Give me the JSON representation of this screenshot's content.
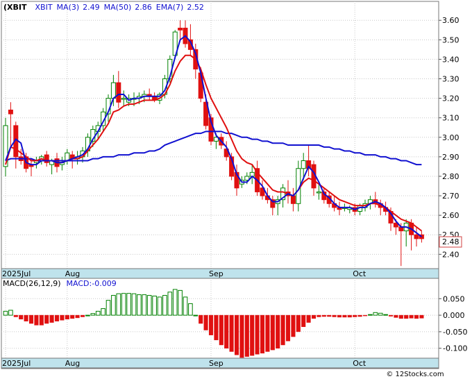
{
  "colors": {
    "ma_short": "#1010d0",
    "ma_long": "#1010d0",
    "ema": "#e01010",
    "up_candle": "#008000",
    "down_candle": "#e01010",
    "axis_strip": "#bfe3ec",
    "macd_bar_pos": "#008000",
    "macd_bar_neg": "#e01010"
  },
  "chart_data": [
    {
      "type": "candlestick",
      "ticker": "(XBIT",
      "indicators": [
        {
          "label": "XBIT",
          "value": ""
        },
        {
          "label": "MA(3)",
          "value": "2.49"
        },
        {
          "label": "MA(50)",
          "value": "2.86"
        },
        {
          "label": "EMA(7)",
          "value": "2.52"
        }
      ],
      "ylim": [
        2.33,
        3.64
      ],
      "y_ticks": [
        "3.60",
        "3.50",
        "3.40",
        "3.30",
        "3.20",
        "3.10",
        "3.00",
        "2.90",
        "2.80",
        "2.70",
        "2.60",
        "2.50",
        "2.40"
      ],
      "last_price": "2.48",
      "date_labels": [
        {
          "label": "2025Jul",
          "index": 0
        },
        {
          "label": "Aug",
          "index": 12
        },
        {
          "label": "Sep",
          "index": 40
        },
        {
          "label": "Oct",
          "index": 68
        }
      ],
      "candles": [
        [
          2.85,
          3.1,
          2.8,
          3.06
        ],
        [
          3.14,
          3.18,
          2.95,
          3.12
        ],
        [
          3.06,
          3.08,
          2.84,
          2.9
        ],
        [
          2.9,
          2.94,
          2.86,
          2.88
        ],
        [
          2.9,
          2.92,
          2.82,
          2.84
        ],
        [
          2.86,
          2.89,
          2.8,
          2.85
        ],
        [
          2.87,
          2.9,
          2.84,
          2.88
        ],
        [
          2.88,
          2.91,
          2.86,
          2.9
        ],
        [
          2.91,
          2.93,
          2.85,
          2.87
        ],
        [
          2.86,
          2.89,
          2.81,
          2.88
        ],
        [
          2.89,
          2.92,
          2.82,
          2.85
        ],
        [
          2.86,
          2.9,
          2.83,
          2.87
        ],
        [
          2.88,
          2.94,
          2.86,
          2.92
        ],
        [
          2.91,
          2.93,
          2.84,
          2.89
        ],
        [
          2.89,
          2.93,
          2.86,
          2.9
        ],
        [
          2.9,
          2.95,
          2.87,
          2.93
        ],
        [
          2.93,
          3.02,
          2.9,
          3.0
        ],
        [
          2.98,
          3.06,
          2.95,
          3.04
        ],
        [
          3.03,
          3.08,
          2.99,
          3.06
        ],
        [
          3.06,
          3.15,
          3.03,
          3.13
        ],
        [
          3.12,
          3.22,
          3.08,
          3.2
        ],
        [
          3.2,
          3.32,
          3.16,
          3.28
        ],
        [
          3.28,
          3.34,
          3.15,
          3.18
        ],
        [
          3.2,
          3.24,
          3.16,
          3.2
        ],
        [
          3.18,
          3.22,
          3.16,
          3.2
        ],
        [
          3.2,
          3.23,
          3.16,
          3.2
        ],
        [
          3.2,
          3.23,
          3.17,
          3.21
        ],
        [
          3.21,
          3.24,
          3.18,
          3.22
        ],
        [
          3.22,
          3.25,
          3.19,
          3.21
        ],
        [
          3.21,
          3.23,
          3.18,
          3.19
        ],
        [
          3.19,
          3.23,
          3.17,
          3.22
        ],
        [
          3.22,
          3.32,
          3.2,
          3.3
        ],
        [
          3.3,
          3.42,
          3.28,
          3.4
        ],
        [
          3.42,
          3.55,
          3.4,
          3.54
        ],
        [
          3.56,
          3.6,
          3.5,
          3.55
        ],
        [
          3.56,
          3.6,
          3.46,
          3.48
        ],
        [
          3.5,
          3.58,
          3.42,
          3.45
        ],
        [
          3.45,
          3.48,
          3.3,
          3.35
        ],
        [
          3.33,
          3.36,
          3.18,
          3.2
        ],
        [
          3.18,
          3.22,
          3.04,
          3.06
        ],
        [
          3.1,
          3.12,
          2.96,
          2.98
        ],
        [
          2.98,
          3.02,
          2.94,
          3.0
        ],
        [
          3.0,
          3.02,
          2.94,
          2.96
        ],
        [
          2.94,
          2.98,
          2.88,
          2.9
        ],
        [
          2.9,
          2.92,
          2.78,
          2.8
        ],
        [
          2.82,
          2.86,
          2.7,
          2.74
        ],
        [
          2.76,
          2.8,
          2.74,
          2.78
        ],
        [
          2.78,
          2.82,
          2.76,
          2.8
        ],
        [
          2.8,
          2.86,
          2.76,
          2.82
        ],
        [
          2.84,
          2.88,
          2.7,
          2.72
        ],
        [
          2.74,
          2.78,
          2.68,
          2.7
        ],
        [
          2.7,
          2.74,
          2.66,
          2.68
        ],
        [
          2.68,
          2.7,
          2.6,
          2.64
        ],
        [
          2.66,
          2.7,
          2.6,
          2.68
        ],
        [
          2.68,
          2.76,
          2.64,
          2.74
        ],
        [
          2.72,
          2.78,
          2.66,
          2.7
        ],
        [
          2.7,
          2.74,
          2.62,
          2.66
        ],
        [
          2.66,
          2.88,
          2.62,
          2.84
        ],
        [
          2.84,
          2.92,
          2.78,
          2.88
        ],
        [
          2.88,
          2.96,
          2.8,
          2.84
        ],
        [
          2.86,
          2.88,
          2.7,
          2.74
        ],
        [
          2.72,
          2.76,
          2.68,
          2.72
        ],
        [
          2.72,
          2.74,
          2.66,
          2.68
        ],
        [
          2.7,
          2.72,
          2.64,
          2.66
        ],
        [
          2.66,
          2.7,
          2.62,
          2.64
        ],
        [
          2.64,
          2.67,
          2.6,
          2.63
        ],
        [
          2.64,
          2.66,
          2.62,
          2.64
        ],
        [
          2.63,
          2.65,
          2.61,
          2.64
        ],
        [
          2.64,
          2.66,
          2.6,
          2.62
        ],
        [
          2.62,
          2.66,
          2.6,
          2.65
        ],
        [
          2.64,
          2.68,
          2.62,
          2.66
        ],
        [
          2.66,
          2.7,
          2.63,
          2.68
        ],
        [
          2.68,
          2.72,
          2.64,
          2.66
        ],
        [
          2.66,
          2.68,
          2.6,
          2.64
        ],
        [
          2.64,
          2.67,
          2.6,
          2.62
        ],
        [
          2.62,
          2.64,
          2.52,
          2.56
        ],
        [
          2.56,
          2.58,
          2.5,
          2.54
        ],
        [
          2.54,
          2.56,
          2.34,
          2.52
        ],
        [
          2.52,
          2.58,
          2.44,
          2.56
        ],
        [
          2.56,
          2.58,
          2.42,
          2.5
        ],
        [
          2.5,
          2.54,
          2.44,
          2.48
        ],
        [
          2.5,
          2.52,
          2.46,
          2.48
        ]
      ],
      "ma3": [
        2.88,
        2.95,
        2.99,
        2.97,
        2.87,
        2.86,
        2.86,
        2.88,
        2.88,
        2.88,
        2.87,
        2.87,
        2.88,
        2.89,
        2.9,
        2.91,
        2.94,
        2.99,
        3.03,
        3.08,
        3.13,
        3.2,
        3.22,
        3.22,
        3.19,
        3.2,
        3.2,
        3.21,
        3.21,
        3.21,
        3.21,
        3.24,
        3.31,
        3.41,
        3.5,
        3.52,
        3.49,
        3.43,
        3.33,
        3.2,
        3.08,
        3.01,
        2.98,
        2.95,
        2.89,
        2.81,
        2.77,
        2.77,
        2.8,
        2.78,
        2.75,
        2.7,
        2.67,
        2.67,
        2.69,
        2.71,
        2.7,
        2.73,
        2.79,
        2.85,
        2.82,
        2.77,
        2.71,
        2.69,
        2.66,
        2.64,
        2.64,
        2.64,
        2.63,
        2.64,
        2.64,
        2.66,
        2.67,
        2.66,
        2.64,
        2.61,
        2.57,
        2.54,
        2.54,
        2.53,
        2.51,
        2.49
      ],
      "ema7": [
        2.86,
        2.95,
        2.94,
        2.92,
        2.9,
        2.88,
        2.88,
        2.89,
        2.88,
        2.88,
        2.87,
        2.87,
        2.88,
        2.89,
        2.89,
        2.9,
        2.93,
        2.96,
        2.99,
        3.03,
        3.07,
        3.13,
        3.14,
        3.16,
        3.17,
        3.17,
        3.18,
        3.19,
        3.19,
        3.19,
        3.2,
        3.22,
        3.27,
        3.34,
        3.39,
        3.42,
        3.42,
        3.4,
        3.35,
        3.27,
        3.2,
        3.15,
        3.1,
        3.05,
        2.99,
        2.93,
        2.89,
        2.87,
        2.86,
        2.82,
        2.79,
        2.76,
        2.73,
        2.72,
        2.72,
        2.71,
        2.7,
        2.73,
        2.77,
        2.79,
        2.78,
        2.76,
        2.74,
        2.72,
        2.7,
        2.68,
        2.67,
        2.66,
        2.65,
        2.65,
        2.65,
        2.66,
        2.66,
        2.65,
        2.64,
        2.62,
        2.6,
        2.58,
        2.57,
        2.56,
        2.54,
        2.52
      ],
      "ma50": [
        2.88,
        2.89,
        2.89,
        2.89,
        2.89,
        2.89,
        2.88,
        2.88,
        2.88,
        2.88,
        2.88,
        2.88,
        2.88,
        2.88,
        2.88,
        2.88,
        2.88,
        2.89,
        2.89,
        2.9,
        2.9,
        2.9,
        2.91,
        2.91,
        2.91,
        2.92,
        2.92,
        2.92,
        2.93,
        2.93,
        2.94,
        2.96,
        2.97,
        2.98,
        2.99,
        3.0,
        3.01,
        3.02,
        3.02,
        3.03,
        3.03,
        3.03,
        3.03,
        3.02,
        3.02,
        3.01,
        3.0,
        3.0,
        2.99,
        2.99,
        2.98,
        2.98,
        2.97,
        2.97,
        2.97,
        2.96,
        2.96,
        2.96,
        2.96,
        2.96,
        2.96,
        2.96,
        2.95,
        2.95,
        2.94,
        2.94,
        2.93,
        2.93,
        2.92,
        2.92,
        2.91,
        2.91,
        2.91,
        2.9,
        2.9,
        2.89,
        2.89,
        2.88,
        2.88,
        2.87,
        2.86,
        2.86
      ]
    },
    {
      "type": "bar",
      "title": "MACD(26,12,9)",
      "legend": "MACD:-0.009",
      "ylim": [
        -0.13,
        0.08
      ],
      "y_ticks": [
        "0.050",
        "0.000",
        "-0.050",
        "-0.100"
      ],
      "date_labels": [
        {
          "label": "2025Jul",
          "index": 0
        },
        {
          "label": "Aug",
          "index": 12
        },
        {
          "label": "Sep",
          "index": 40
        },
        {
          "label": "Oct",
          "index": 68
        }
      ],
      "values": [
        0.012,
        0.015,
        -0.005,
        -0.012,
        -0.018,
        -0.025,
        -0.03,
        -0.03,
        -0.025,
        -0.022,
        -0.018,
        -0.015,
        -0.012,
        -0.01,
        -0.008,
        -0.005,
        0.0,
        0.005,
        0.012,
        0.02,
        0.045,
        0.06,
        0.065,
        0.066,
        0.066,
        0.065,
        0.062,
        0.062,
        0.06,
        0.058,
        0.055,
        0.06,
        0.07,
        0.078,
        0.075,
        0.055,
        0.035,
        0.0,
        -0.025,
        -0.045,
        -0.06,
        -0.075,
        -0.09,
        -0.1,
        -0.11,
        -0.12,
        -0.128,
        -0.125,
        -0.122,
        -0.118,
        -0.115,
        -0.11,
        -0.105,
        -0.1,
        -0.09,
        -0.078,
        -0.065,
        -0.05,
        -0.035,
        -0.022,
        -0.01,
        -0.005,
        -0.004,
        -0.004,
        -0.005,
        -0.006,
        -0.006,
        -0.006,
        -0.005,
        -0.004,
        -0.002,
        0.002,
        0.008,
        0.006,
        0.002,
        -0.003,
        -0.007,
        -0.01,
        -0.01,
        -0.009,
        -0.01,
        -0.009
      ]
    }
  ],
  "footer": {
    "credit": "© 12Stocks.com"
  }
}
